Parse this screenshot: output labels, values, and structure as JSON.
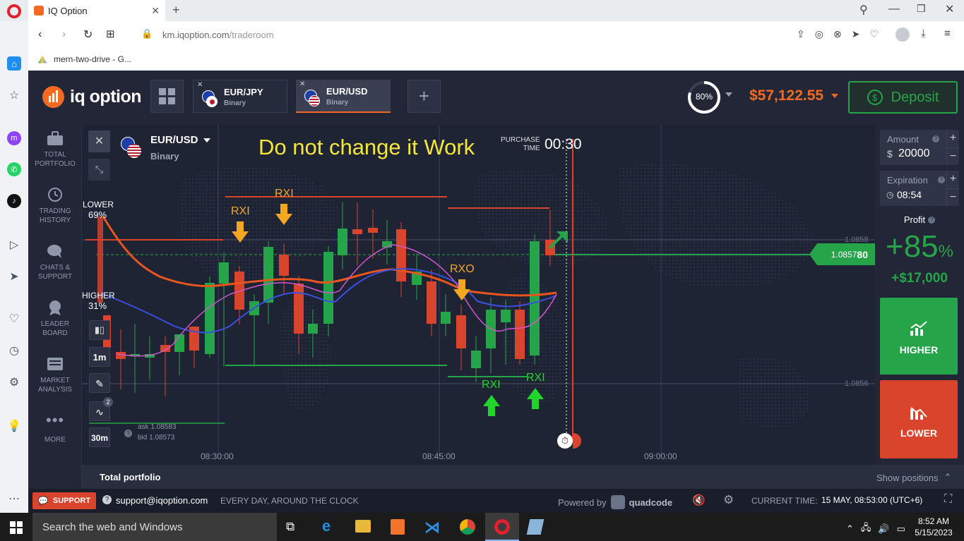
{
  "browser": {
    "tab_title": "IQ Option",
    "url_host": "km.iqoption.com",
    "url_path": "/traderoom",
    "bookmark": "mern-two-drive - G..."
  },
  "header": {
    "logo_text": "iq option",
    "assets": [
      {
        "name": "EUR/JPY",
        "type": "Binary"
      },
      {
        "name": "EUR/USD",
        "type": "Binary"
      }
    ],
    "progress_label": "80%",
    "progress_value": 0.8,
    "balance": "$57,122.55",
    "deposit_label": "Deposit"
  },
  "nav": [
    {
      "label1": "TOTAL",
      "label2": "PORTFOLIO",
      "icon": "briefcase-icon"
    },
    {
      "label1": "TRADING",
      "label2": "HISTORY",
      "icon": "history-icon"
    },
    {
      "label1": "CHATS &",
      "label2": "SUPPORT",
      "icon": "chat-icon"
    },
    {
      "label1": "LEADER",
      "label2": "BOARD",
      "icon": "leaderboard-icon"
    },
    {
      "label1": "MARKET",
      "label2": "ANALYSIS",
      "icon": "market-analysis-icon"
    },
    {
      "label1": "MORE",
      "label2": "",
      "icon": "more-icon"
    }
  ],
  "chart": {
    "asset": "EUR/USD",
    "asset_type": "Binary",
    "annotation": "Do not change it Work",
    "purchase_label1": "PURCHASE",
    "purchase_label2": "TIME",
    "purchase_time": "00:30",
    "lower_label": "LOWER",
    "lower_pct": "69%",
    "higher_label": "HIGHER",
    "higher_pct": "31%",
    "timeframe_1": "1m",
    "timeframe_2": "30m",
    "indicators_count": "2",
    "ask": "ask 1.08583",
    "bid": "bid 1.08573",
    "price_main": "1.0857",
    "price_bold": "80",
    "level_upper": "1.0858",
    "level_lower": "1.0856",
    "times": [
      "08:30:00",
      "08:45:00",
      "09:00:00"
    ],
    "signals": [
      "RXI",
      "RXI",
      "RXO",
      "RXI",
      "RXI"
    ]
  },
  "trade": {
    "amount_label": "Amount",
    "amount_currency": "$",
    "amount_value": "20000",
    "expiration_label": "Expiration",
    "expiration_value": "08:54",
    "profit_label": "Profit",
    "profit_pct_big": "+85",
    "profit_pct_sign": "%",
    "profit_amount": "+$17,000",
    "higher_btn": "HIGHER",
    "lower_btn": "LOWER"
  },
  "portfolio": {
    "title": "Total portfolio",
    "show_positions": "Show positions"
  },
  "status": {
    "support_btn": "SUPPORT",
    "support_email": "support@iqoption.com",
    "support_hours": "EVERY DAY, AROUND THE CLOCK",
    "powered_by": "Powered by",
    "powered_brand": "quadcode",
    "current_time_label": "CURRENT TIME:",
    "current_time_value": "15 MAY, 08:53:00 (UTC+6)"
  },
  "taskbar": {
    "search_placeholder": "Search the web and Windows",
    "clock_time": "8:52 AM",
    "clock_date": "5/15/2023"
  },
  "colors": {
    "green": "#26a449",
    "red": "#d9452c",
    "orange": "#f5a623",
    "balance": "#f36a22"
  },
  "chart_data": {
    "type": "candlestick",
    "x": [
      "08:30:00",
      "08:45:00",
      "09:00:00"
    ],
    "ylim": [
      1.0855,
      1.0859
    ]
  }
}
